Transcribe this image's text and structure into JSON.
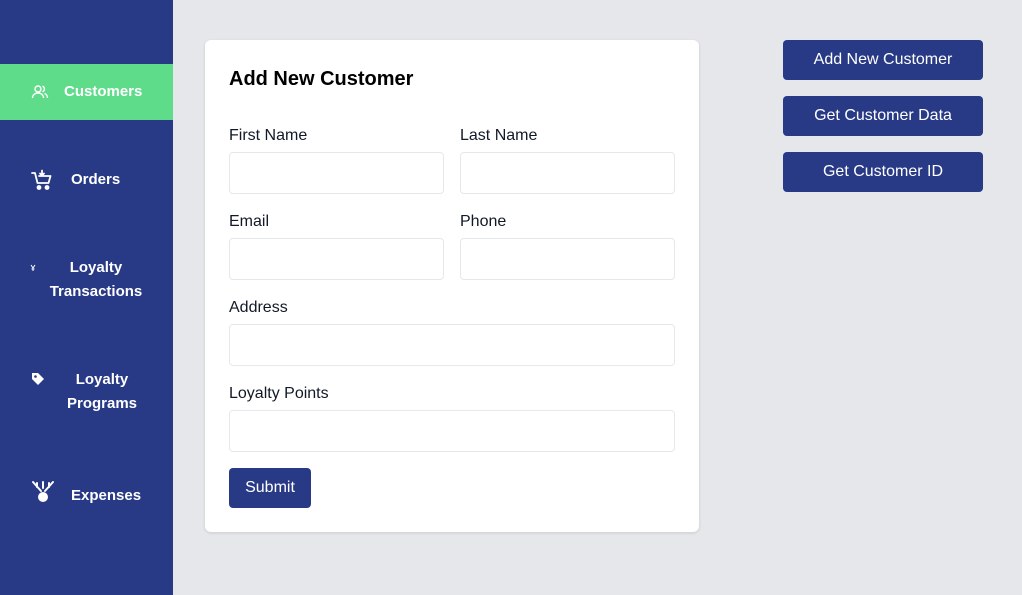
{
  "sidebar": {
    "items": [
      {
        "label": "Customers",
        "icon": "users-icon",
        "active": true
      },
      {
        "label": "Orders",
        "icon": "cart-icon",
        "active": false
      },
      {
        "label": "Loyalty Transactions",
        "icon": "currency-icon",
        "active": false
      },
      {
        "label": "Loyalty Programs",
        "icon": "tag-icon",
        "active": false
      },
      {
        "label": "Expenses",
        "icon": "money-icon",
        "active": false
      }
    ]
  },
  "form": {
    "title": "Add New Customer",
    "fields": {
      "first_name": {
        "label": "First Name",
        "value": ""
      },
      "last_name": {
        "label": "Last Name",
        "value": ""
      },
      "email": {
        "label": "Email",
        "value": ""
      },
      "phone": {
        "label": "Phone",
        "value": ""
      },
      "address": {
        "label": "Address",
        "value": ""
      },
      "loyalty_points": {
        "label": "Loyalty Points",
        "value": ""
      }
    },
    "submit_label": "Submit"
  },
  "actions": {
    "add_new_customer": "Add New Customer",
    "get_customer_data": "Get Customer Data",
    "get_customer_id": "Get Customer ID"
  },
  "colors": {
    "sidebar_bg": "#283a86",
    "active_item_bg": "#5fdc8a",
    "page_bg": "#e5e7eb",
    "button_bg": "#283a86"
  }
}
